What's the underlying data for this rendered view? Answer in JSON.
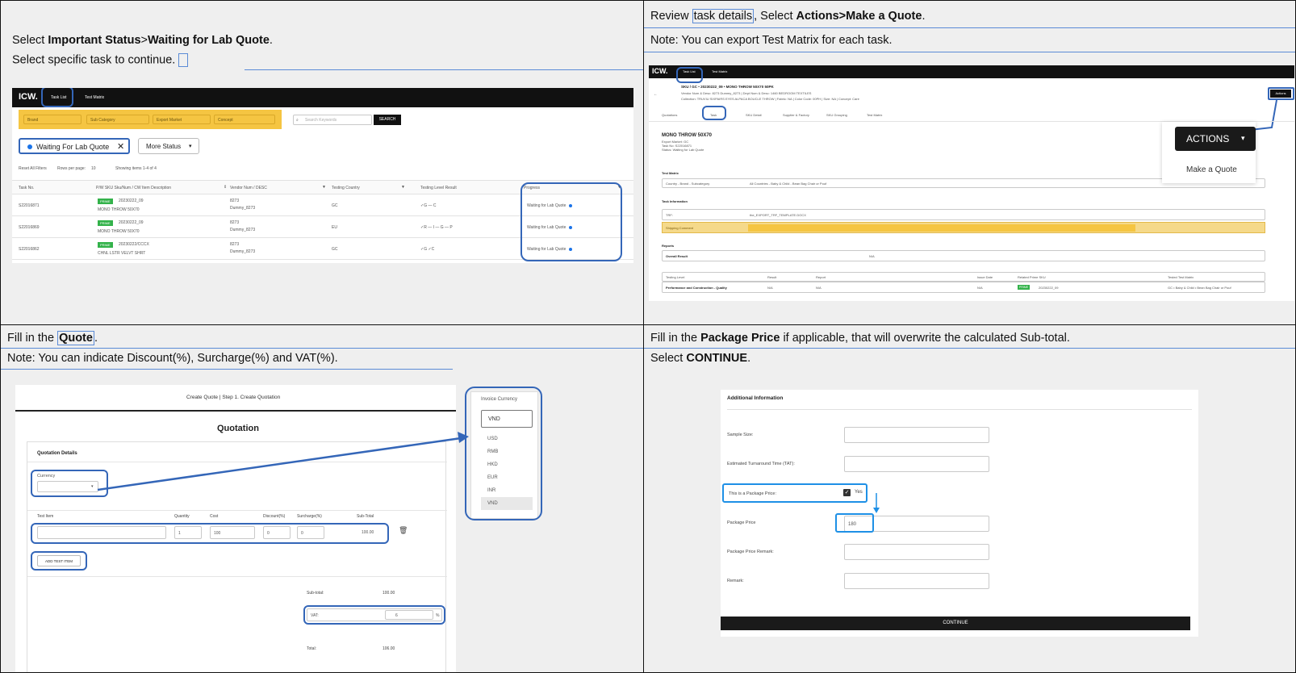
{
  "panel1": {
    "line1_a": "Select ",
    "line1_b": "Important Status",
    ">": ">",
    "line1_c": "Waiting for Lab Quote",
    "line1_d": ".",
    "line2": "Select specific task to continue.",
    "nav": {
      "logo": "ICW.",
      "tab1": "Task List",
      "tab2": "Test Matrix"
    },
    "filters": [
      "Brand",
      "Sub Category",
      "Export Market",
      "Concept"
    ],
    "search_placeholder": "Search Keywords",
    "search_btn": "SEARCH",
    "status_chip": "Waiting For Lab Quote",
    "more_status": "More Status",
    "pager": {
      "reset": "Reset All Filters",
      "rows": "Rows per page:",
      "rows_val": "10",
      "showing": "Showing items 1-4 of 4"
    },
    "headers": [
      "Task No.",
      "P/W SKU Sku/Num / CW Item Description",
      "Vendor Num / DESC",
      "Testing Country",
      "Testing Level Result",
      "Progress"
    ],
    "rows": [
      {
        "task": "S22016871",
        "badge": "PRIME",
        "sku": "20230222_09",
        "desc": "MONO THROW 50X70",
        "vendor": "8273",
        "vname": "Dummy_8273",
        "country": "GC",
        "level": "✓G   — C",
        "progress": "Waiting for Lab Quote"
      },
      {
        "task": "S22016869",
        "badge": "PRIME",
        "sku": "20230222_09",
        "desc": "MONO THROW 50X70",
        "vendor": "8273",
        "vname": "Dummy_8273",
        "country": "EU",
        "level": "✓R   — I   — G   — P",
        "progress": "Waiting for Lab Quote"
      },
      {
        "task": "S22016862",
        "badge": "PRIME",
        "sku": "20230222/CCCX",
        "desc": "CHNL LSTR VELVT SHRT",
        "vendor": "8273",
        "vname": "Dummy_8273",
        "country": "GC",
        "level": "✓G   ✓C",
        "progress": "Waiting for Lab Quote"
      }
    ]
  },
  "panel2": {
    "line1_a": "Review ",
    "line1_b": "task details",
    "line1_c": ", Select ",
    "line1_d": "Actions>Make a Quote",
    "line1_e": ".",
    "line2": "Note: You can export Test Matrix for each task.",
    "nav": {
      "logo": "ICW.",
      "tab1": "Task List",
      "tab2": "Test Matrix"
    },
    "breadcrumb": "SKU / GC • 20230222_09 • MONO THROW 50X70 50PK",
    "sub1": "Vendor Num & Desc: 8273 Dummy_8273 | Dept Num & Desc: 1460 BEDROOM TEXTILES",
    "sub2": "Collection: TRUVIU SIXPAIRS EYES ALPACA BOUCLE THROW | Fabric: NA | Color Code: 00PH | Size: NA | Concept: Care",
    "tabs": [
      "Quotations",
      "Task",
      "SKU Detail",
      "Supplier & Factory",
      "SKU Grouping",
      "Test Matrix"
    ],
    "task_title": "MONO THROW 50X70",
    "task_meta1": "Export Market: GC",
    "task_meta2": "Task No: S22016871",
    "task_meta3": "Status: Waiting for Lab Quote",
    "actions_small": "Actions",
    "actions_btn": "ACTIONS",
    "make_quote": "Make a Quote",
    "test_matrix": "Test Matrix",
    "tm_c1": "Country - Brand - Subcategory",
    "tm_c2": "All Countries - Baby & Child - Bean Bag Chair or Pouf",
    "task_info": "Task Information",
    "ti_r1a": "TRF:",
    "ti_r1b": "the_EXPORT_TRF_TEMPLATE.DOCX",
    "ti_r2a": "Shipping Comment",
    "reports": "Reports",
    "overall": "Overall Result",
    "overall_val": "N/A",
    "rep_headers": [
      "Testing Level",
      "Result",
      "Report",
      "Issue Date",
      "Related Prime SKU",
      "Tested Test Matrix"
    ],
    "rep_row": [
      "Performance and Construction - Quality",
      "N/A",
      "N/A",
      "N/A",
      "20230222_09",
      "GC • Baby & Child • Bean Bag Chair or Pouf"
    ],
    "rep_badge": "PRIME"
  },
  "panel3": {
    "line1_a": "Fill in the ",
    "line1_b": "Quote",
    "line1_c": ".",
    "line2": "Note: You can indicate Discount(%), Surcharge(%) and VAT(%).",
    "header": "Create Quote  |  Step 1. Create Quotation",
    "title": "Quotation",
    "section": "Quotation Details",
    "currency": "Currency",
    "cols": [
      "Test Item",
      "Quantity",
      "Cost",
      "Discount(%)",
      "Surcharge(%)",
      "Sub-Total"
    ],
    "item": {
      "qty": "1",
      "cost": "100",
      "disc": "0",
      "sur": "0",
      "sub": "100.00"
    },
    "add_btn": "ADD TEST ITEM",
    "subtotal_lbl": "Sub-total:",
    "subtotal_val": "100.00",
    "vat_lbl": "VAT:",
    "vat_val": "6",
    "pct": "%",
    "total_lbl": "Total:",
    "total_val": "106.00",
    "dropdown": {
      "label": "Invoice Currency",
      "selected": "VND",
      "options": [
        "USD",
        "RMB",
        "HKD",
        "EUR",
        "INR",
        "VND"
      ]
    }
  },
  "panel4": {
    "line1_a": "Fill in the ",
    "line1_b": "Package Price",
    "line1_c": " if applicable, that will overwrite the calculated Sub-total.",
    "line2_a": "Select ",
    "line2_b": "CONTINUE",
    "line2_c": ".",
    "section": "Additional Information",
    "sample": "Sample Size:",
    "tat": "Estimated Turnaround Time (TAT):",
    "pkg_q": "This is a Package Price:",
    "yes": "Yes",
    "pkg_price": "Package Price",
    "pkg_val": "180",
    "pkg_remark": "Package Price Remark:",
    "remark": "Remark:",
    "continue": "CONTINUE"
  },
  "colors": {
    "blue": "#3466b8",
    "yellow": "#f5c542",
    "prime": "#33b24a",
    "dark": "#111111"
  }
}
